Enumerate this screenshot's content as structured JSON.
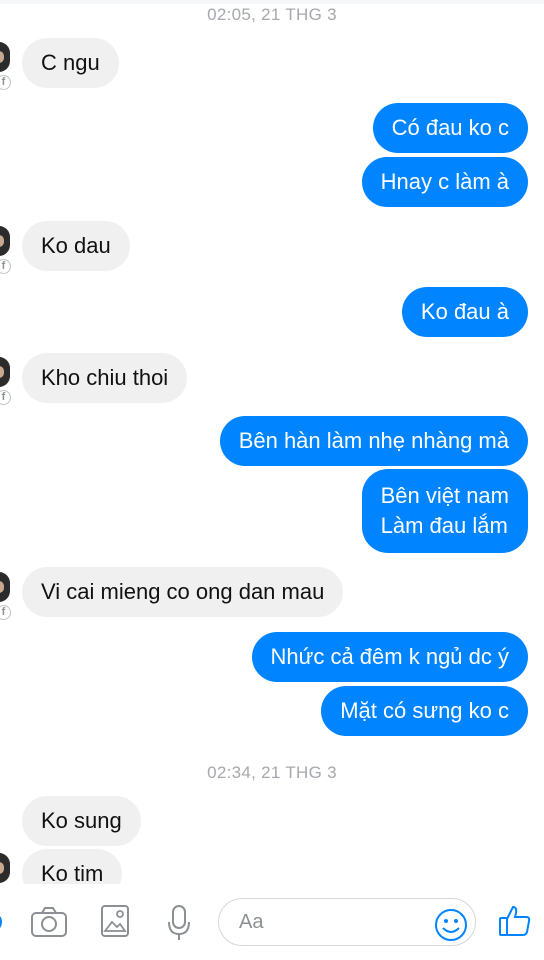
{
  "timestamps": {
    "first": "02:05, 21 THG 3",
    "second": "02:34, 21 THG 3"
  },
  "messages": [
    {
      "side": "in",
      "text": "C ngu"
    },
    {
      "side": "out",
      "text": "Có đau ko c"
    },
    {
      "side": "out",
      "text": "Hnay c làm à"
    },
    {
      "side": "in",
      "text": "Ko dau"
    },
    {
      "side": "out",
      "text": "Ko đau à"
    },
    {
      "side": "in",
      "text": "Kho chiu thoi"
    },
    {
      "side": "out",
      "text": "Bên hàn làm nhẹ nhàng mà"
    },
    {
      "side": "out",
      "lines": [
        "Bên việt nam",
        "Làm đau lắm"
      ]
    },
    {
      "side": "in",
      "text": "Vi cai mieng co ong dan mau"
    },
    {
      "side": "out",
      "text": "Nhức cả đêm k ngủ dc ý"
    },
    {
      "side": "out",
      "text": "Mặt có sưng ko c"
    },
    {
      "side": "in",
      "text": "Ko sung"
    },
    {
      "side": "in",
      "text": "Ko tim"
    }
  ],
  "composer": {
    "placeholder": "Aa",
    "icons": [
      "camera-icon",
      "gallery-icon",
      "microphone-icon",
      "emoji-icon",
      "thumbs-up-icon"
    ],
    "accent": "#0084ff"
  },
  "colors": {
    "outgoing_bubble": "#0084ff",
    "incoming_bubble": "#f1f0f0",
    "timestamp": "#a6a8ad"
  }
}
